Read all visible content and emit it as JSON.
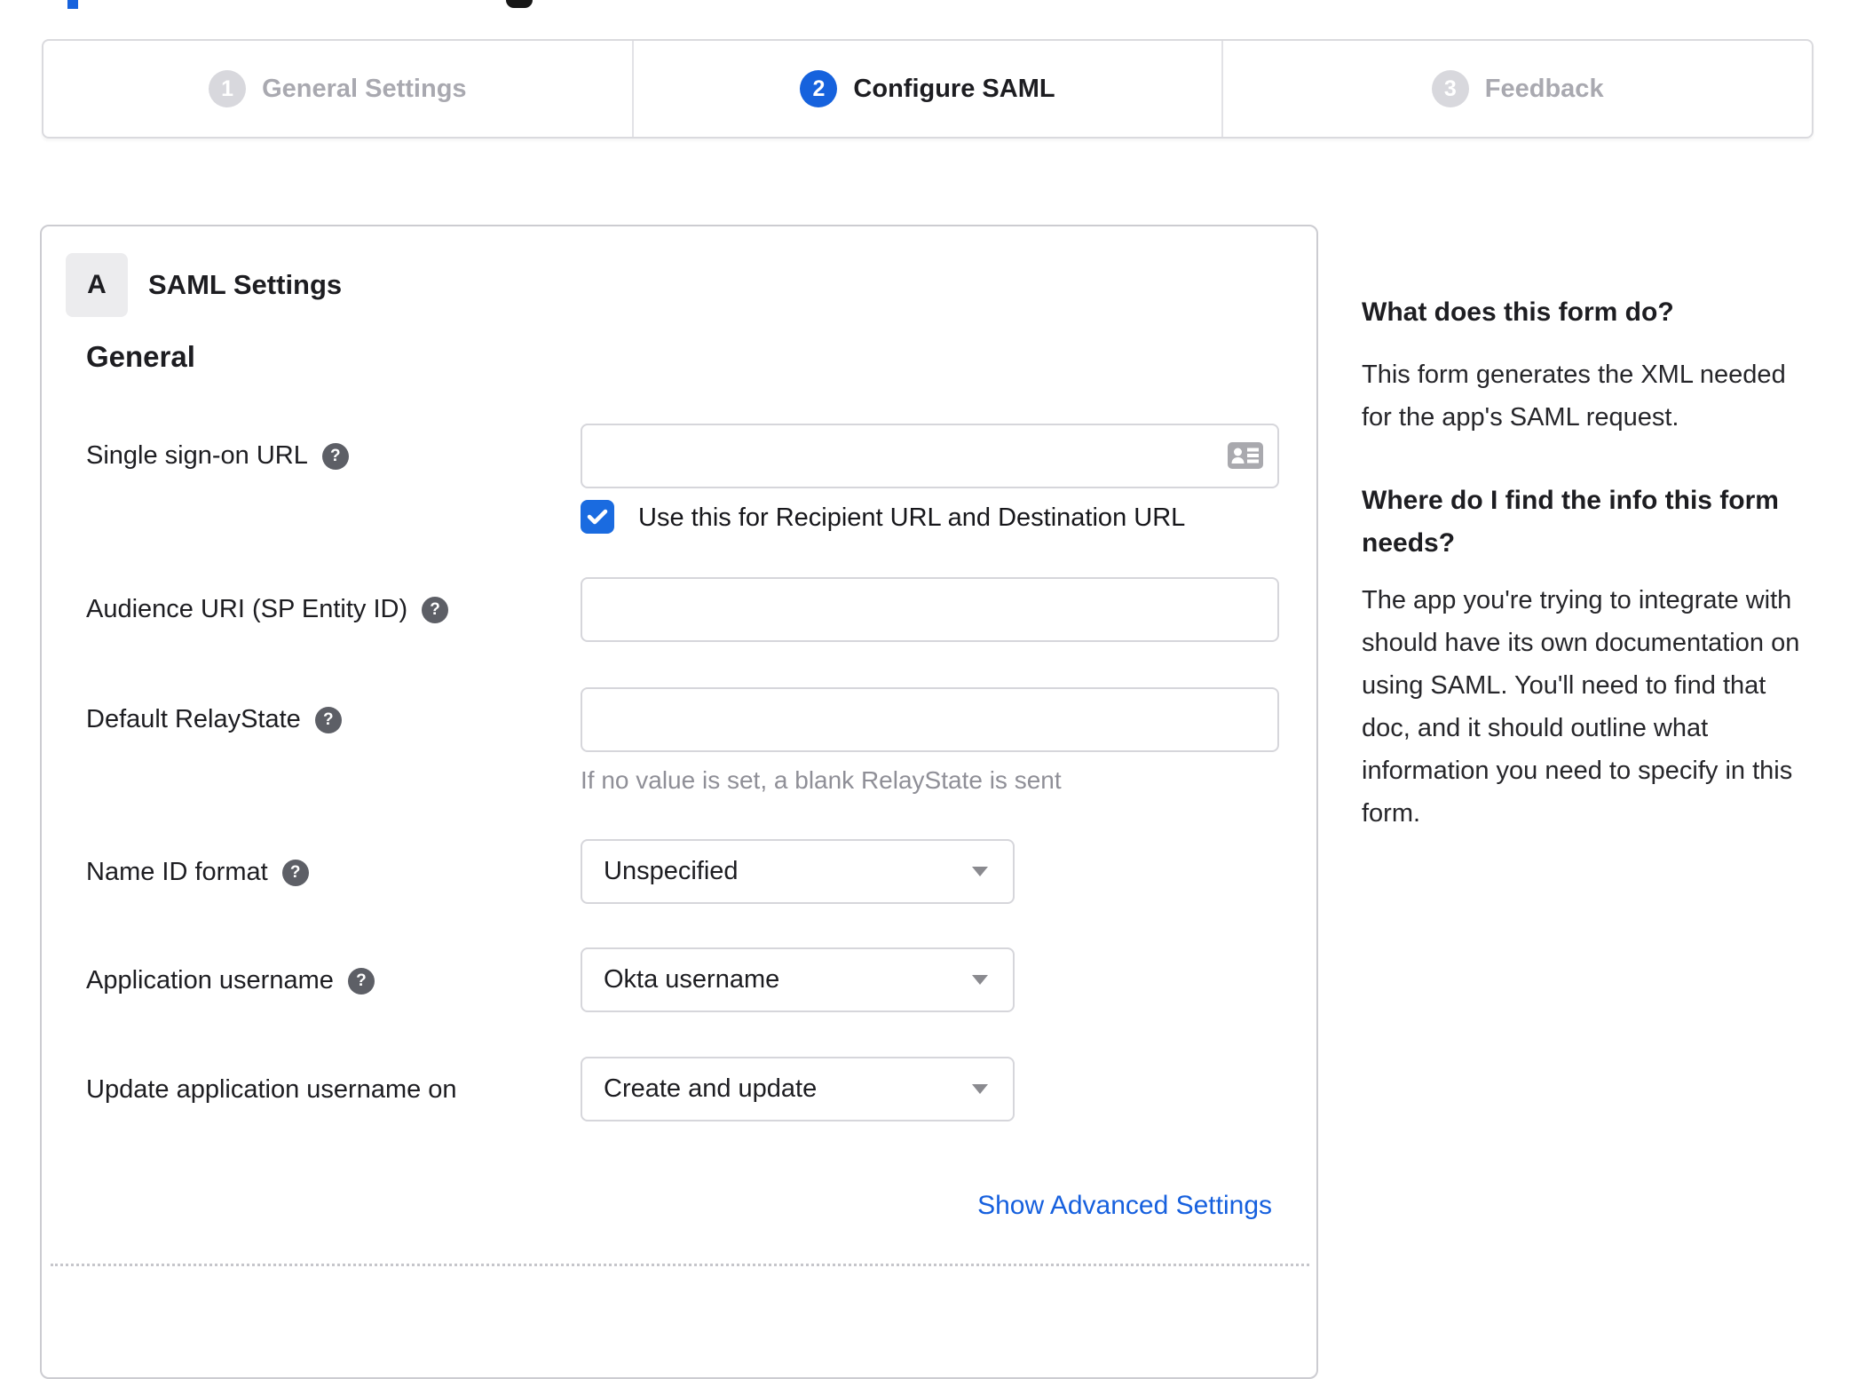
{
  "colors": {
    "accent_blue": "#1662dd",
    "checkbox_blue": "#1a6be0",
    "inactive_gray": "#a9a9b0",
    "step_circle_gray": "#d8d8dd",
    "border_gray": "#d6d6db",
    "hint_gray": "#8f8f97",
    "text_dark": "#1d1d21"
  },
  "icons": {
    "help": "question-mark-icon",
    "sso_input": "contact-card-icon",
    "checkbox": "checkmark-icon",
    "select_arrow": "caret-down-icon"
  },
  "stepper": {
    "steps": [
      {
        "number": "1",
        "label": "General Settings",
        "state": "inactive"
      },
      {
        "number": "2",
        "label": "Configure SAML",
        "state": "active"
      },
      {
        "number": "3",
        "label": "Feedback",
        "state": "inactive"
      }
    ]
  },
  "panel": {
    "section_badge": "A",
    "section_title": "SAML Settings",
    "group_heading": "General",
    "fields": {
      "sso_url": {
        "label": "Single sign-on URL",
        "value": "",
        "has_help": true
      },
      "sso_checkbox": {
        "checked": true,
        "label": "Use this for Recipient URL and Destination URL"
      },
      "audience_uri": {
        "label": "Audience URI (SP Entity ID)",
        "value": "",
        "has_help": true
      },
      "relay_state": {
        "label": "Default RelayState",
        "value": "",
        "has_help": true,
        "hint": "If no value is set, a blank RelayState is sent"
      },
      "name_id_format": {
        "label": "Name ID format",
        "value": "Unspecified",
        "has_help": true
      },
      "application_username": {
        "label": "Application username",
        "value": "Okta username",
        "has_help": true
      },
      "update_application_username_on": {
        "label": "Update application username on",
        "value": "Create and update",
        "has_help": false
      }
    },
    "advanced_link": "Show Advanced Settings"
  },
  "sidebar": {
    "q1": "What does this form do?",
    "a1": "This form generates the XML needed for the app's SAML request.",
    "a1_lines": [
      "This form generates the XML needed",
      "for the app's SAML request."
    ],
    "q2": "Where do I find the info this form needs?",
    "q2_lines": [
      "Where do I find the info this form",
      "needs?"
    ],
    "a2": "The app you're trying to integrate with should have its own documentation on using SAML. You'll need to find that doc, and it should outline what information you need to specify in this form.",
    "a2_lines": [
      "The app you're trying to integrate with",
      "should have its own documentation on",
      "using SAML. You'll need to find that",
      "doc, and it should outline what",
      "information you need to specify in this",
      "form."
    ]
  }
}
